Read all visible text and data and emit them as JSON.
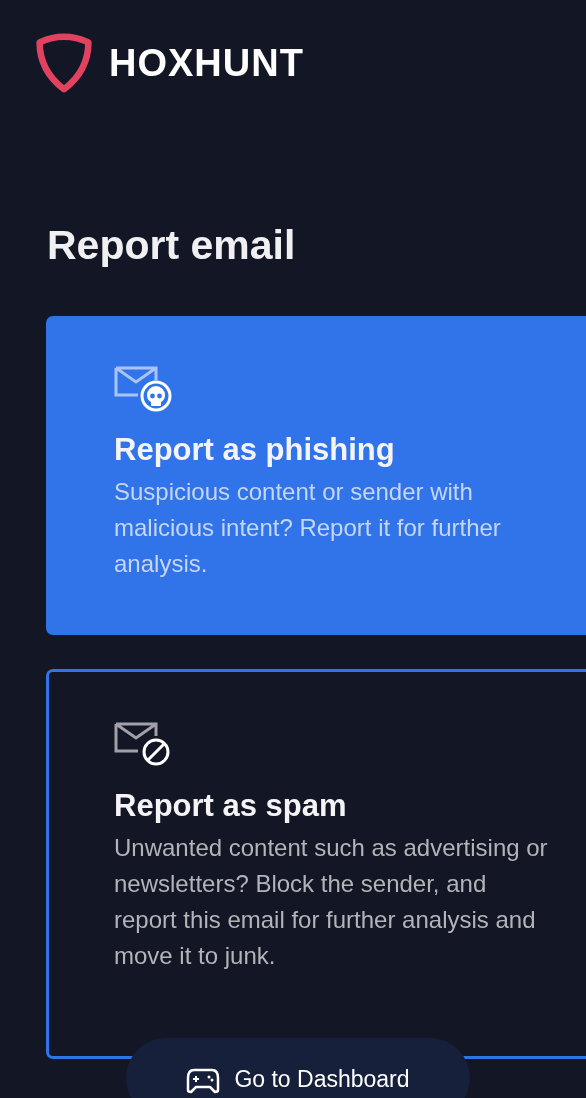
{
  "brand": {
    "name": "HOXHUNT"
  },
  "title": "Report email",
  "options": [
    {
      "kind": "phishing",
      "selected": true,
      "title": "Report as phishing",
      "description": "Suspicious content or sender with malicious intent? Report it for further analysis."
    },
    {
      "kind": "spam",
      "selected": false,
      "title": "Report as spam",
      "description": "Unwanted content such as advertising or newsletters? Block the sender, and report this email for further analysis and move it to junk."
    }
  ],
  "dashboard_button": {
    "label": "Go to Dashboard"
  }
}
